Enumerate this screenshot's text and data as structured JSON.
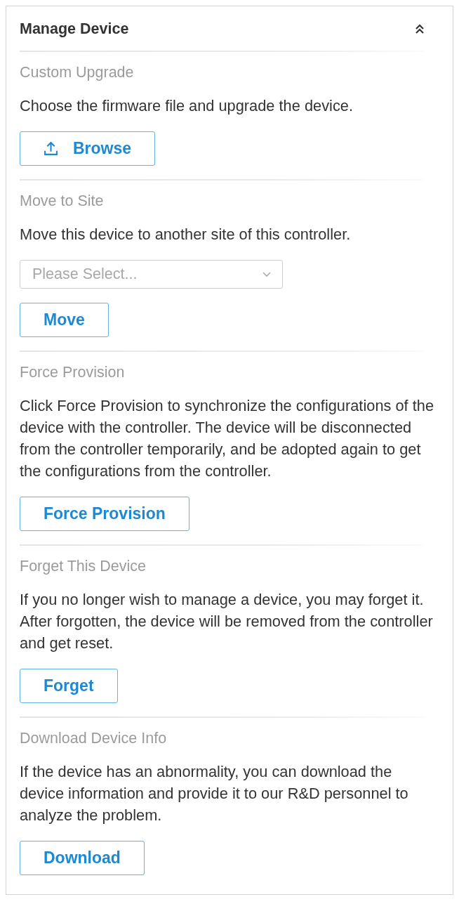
{
  "panel": {
    "title": "Manage Device",
    "expanded": true
  },
  "sections": [
    {
      "kind": "upload",
      "title": "Custom Upgrade",
      "description": "Choose the firmware file and upgrade the device.",
      "button": "Browse"
    },
    {
      "kind": "select",
      "title": "Move to Site",
      "description": "Move this device to another site of this controller.",
      "select": {
        "placeholder": "Please Select..."
      },
      "button": "Move"
    },
    {
      "kind": "action",
      "title": "Force Provision",
      "description": "Click Force Provision to synchronize the configurations of the device with the controller. The device will be disconnected from the controller temporarily, and be adopted again to get the configurations from the controller.",
      "button": "Force Provision"
    },
    {
      "kind": "action",
      "title": "Forget This Device",
      "description": "If you no longer wish to manage a device, you may forget it. After forgotten, the device will be removed from the controller and get reset.",
      "button": "Forget"
    },
    {
      "kind": "action",
      "title": "Download Device Info",
      "description": "If the device has an abnormality, you can download the device information and provide it to our R&D personnel to analyze the problem.",
      "button": "Download"
    }
  ]
}
